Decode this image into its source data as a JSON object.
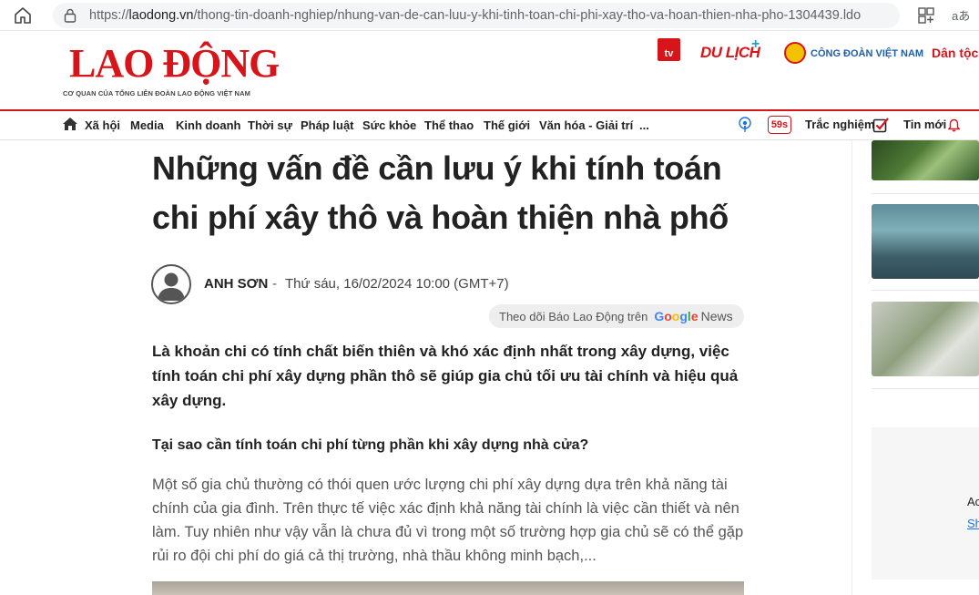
{
  "browser": {
    "url_prefix": "https://",
    "url_host": "laodong.vn",
    "url_path": "/thong-tin-doanh-nghiep/nhung-van-de-can-luu-y-khi-tinh-toan-chi-phi-xay-tho-va-hoan-thien-nha-pho-1304439.ldo",
    "read_aloud": "aあ"
  },
  "header": {
    "logo": "LAO ĐỘNG",
    "logo_subtitle": "CƠ QUAN CỦA TỔNG LIÊN ĐOÀN LAO ĐỘNG VIỆT NAM",
    "partners": {
      "tv": "tv",
      "dulich": "DU LỊCH",
      "dulich_plus": "+",
      "congdoan": "CÔNG ĐOÀN VIỆT NAM",
      "dantoc": "Dân tộc"
    }
  },
  "nav": {
    "items": [
      "Xã hội",
      "Media",
      "Kinh doanh",
      "Thời sự",
      "Pháp luật",
      "Sức khỏe",
      "Thể thao",
      "Thế giới",
      "Văn hóa - Giải trí",
      "..."
    ],
    "badge": "59s",
    "quiz": "Trắc nghiệm",
    "latest": "Tin mới"
  },
  "article": {
    "title": "Những vấn đề cần lưu ý khi tính toán chi phí xây thô và hoàn thiện nhà phố",
    "author": "ANH SƠN",
    "separator": "-",
    "date": "Thứ sáu, 16/02/2024 10:00 (GMT+7)",
    "follow_text": "Theo dõi Báo Lao Động trên",
    "google": [
      "G",
      "o",
      "o",
      "g",
      "l",
      "e"
    ],
    "news": "News",
    "sapo": "Là khoản chi có tính chất biến thiên và khó xác định nhất trong xây dựng, việc tính toán chi phí xây dựng phần thô sẽ giúp gia chủ tối ưu tài chính và hiệu quả xây dựng.",
    "heading": "Tại sao cần tính toán chi phí từng phần khi xây dựng nhà cửa?",
    "paragraph": "Một số gia chủ thường có thói quen ước lượng chi phí xây dựng dựa trên khả năng tài chính của gia đình. Trên thực tế việc xác định khả năng tài chính là việc cần thiết và nên làm. Tuy nhiên như vậy vẫn là chưa đủ vì trong một số trường hợp gia chủ sẽ có thể gặp rủi ro đội chi phí do giá cả thị trường, nhà thầu không minh bạch,..."
  },
  "sidebar": {
    "ad_text": "Ac",
    "ad_link": "Sh"
  }
}
